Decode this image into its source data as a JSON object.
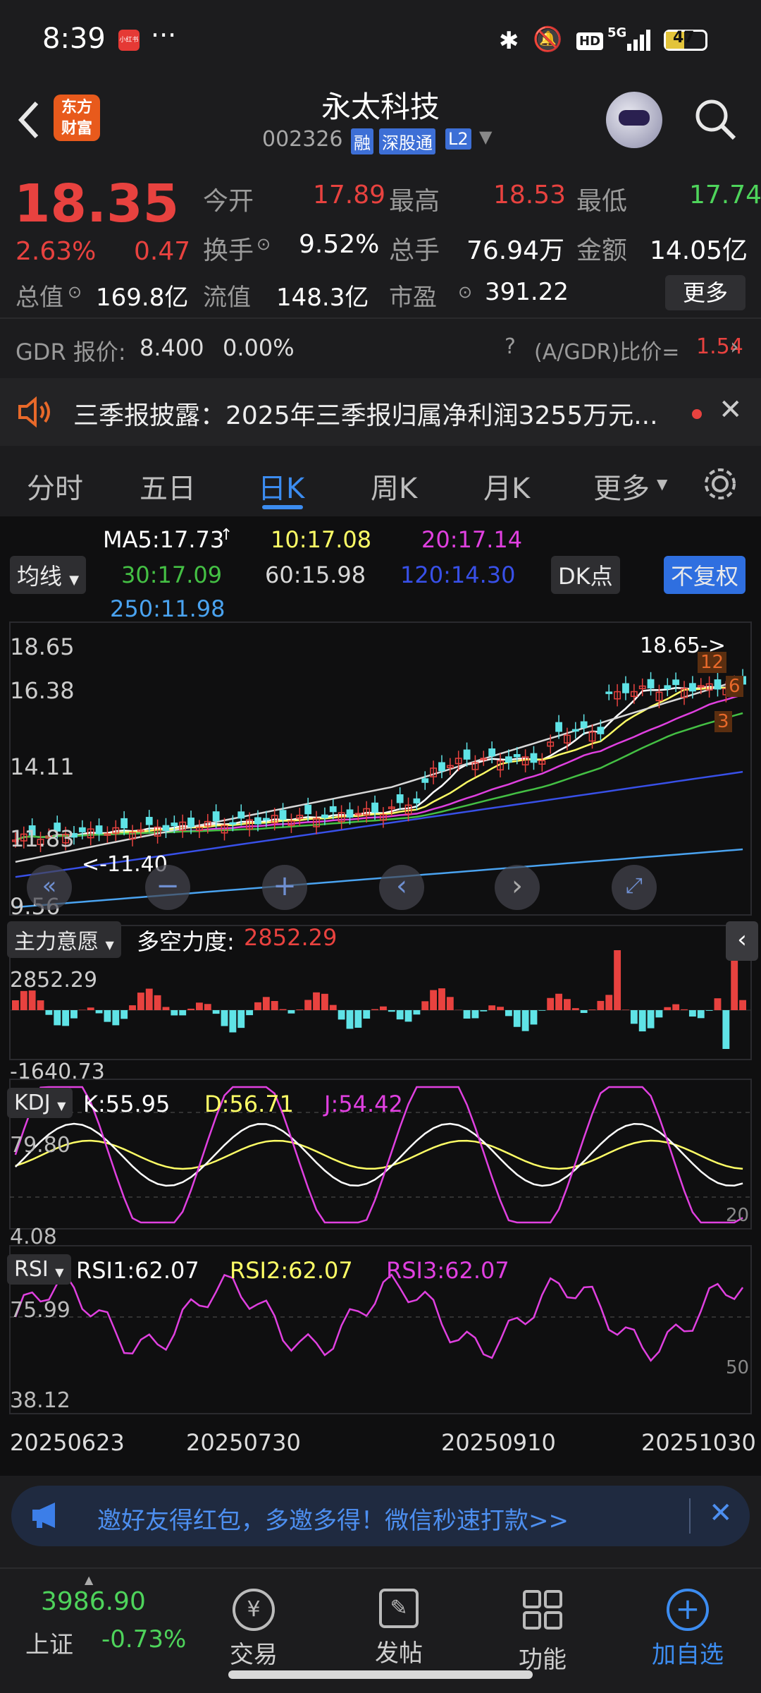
{
  "status": {
    "time": "8:39",
    "badge": "小红书",
    "more": "···",
    "battery": "47"
  },
  "nav": {
    "title": "永太科技",
    "code": "002326",
    "tags": [
      "融",
      "深股通",
      "L2"
    ]
  },
  "quote": {
    "price": "18.35",
    "pct": "2.63%",
    "chg": "0.47",
    "row1": [
      {
        "k": "今开",
        "v": "17.89"
      },
      {
        "k": "最高",
        "v": "18.53"
      },
      {
        "k": "最低",
        "v": "17.74"
      }
    ],
    "row2": [
      {
        "k": "换手",
        "v": "9.52%"
      },
      {
        "k": "总手",
        "v": "76.94万"
      },
      {
        "k": "金额",
        "v": "14.05亿"
      }
    ],
    "row3": [
      {
        "k": "总值",
        "v": "169.8亿"
      },
      {
        "k": "流值",
        "v": "148.3亿"
      },
      {
        "k": "市盈",
        "v": "391.22"
      }
    ],
    "more_btn": "更多",
    "gdr_label": "GDR 报价:",
    "gdr_price": "8.400",
    "gdr_pct": "0.00%",
    "gdr_ratio_label": "(A/GDR)比价=",
    "gdr_ratio": "1.54"
  },
  "notice": {
    "text": "三季报披露：2025年三季报归属净利润3255万元..."
  },
  "tabs": [
    "分时",
    "五日",
    "日K",
    "周K",
    "月K",
    "更多"
  ],
  "ma": {
    "ma5": "MA5:17.73",
    "ma10": "10:17.08",
    "ma20": "20:17.14",
    "ma30": "30:17.09",
    "ma60": "60:15.98",
    "ma120": "120:14.30",
    "ma250": "250:11.98",
    "junxian": "均线",
    "dk": "DK点",
    "fq": "不复权"
  },
  "main_chart": {
    "y_labels": [
      "18.65",
      "16.38",
      "14.11",
      "11.83",
      "9.56"
    ],
    "hi_label": "18.65->",
    "lo_label": "<-11.40",
    "markers": [
      "12",
      "6",
      "3"
    ]
  },
  "vol": {
    "selector": "主力意愿",
    "title": "多空力度:",
    "value": "2852.29",
    "top": "2852.29",
    "bottom": "-1640.73"
  },
  "kdj": {
    "selector": "KDJ",
    "k": "K:55.95",
    "d": "D:56.71",
    "j": "J:54.42",
    "top": "79.80",
    "bottom": "4.08",
    "ref": "20"
  },
  "rsi": {
    "selector": "RSI",
    "r1": "RSI1:62.07",
    "r2": "RSI2:62.07",
    "r3": "RSI3:62.07",
    "top": "75.99",
    "bottom": "38.12",
    "ref": "50"
  },
  "dates": [
    "20250623",
    "20250730",
    "20250910",
    "20251030"
  ],
  "ad": {
    "text": "邀好友得红包，多邀多得！微信秒速打款>>"
  },
  "bottom": {
    "index_value": "3986.90",
    "index_name": "上证",
    "index_chg": "-0.73%",
    "items": [
      "交易",
      "发帖",
      "功能",
      "加自选"
    ]
  },
  "colors": {
    "up": "#e8423f",
    "down": "#5fe3e6",
    "ma5": "#ffffff",
    "ma10": "#ffff66",
    "ma20": "#e040e0",
    "ma30": "#44c044",
    "ma60": "#d8d8d8",
    "ma120": "#3850e8",
    "ma250": "#4aa3f0",
    "accent": "#3c8cf0"
  }
}
